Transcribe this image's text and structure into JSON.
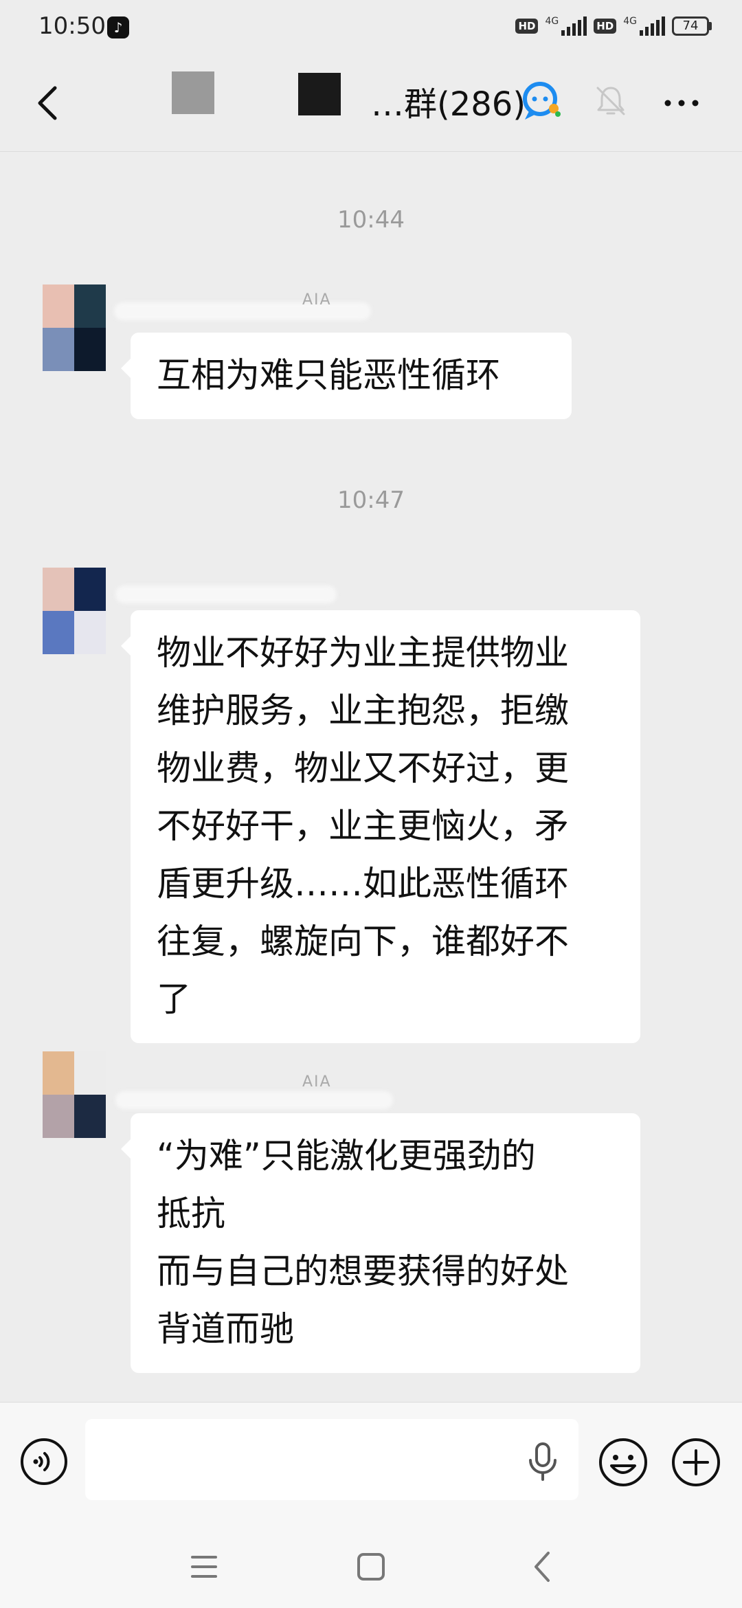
{
  "status_bar": {
    "time": "10:50",
    "hd1": "HD",
    "net1": "4G",
    "hd2": "HD",
    "net2": "4G",
    "battery": "74"
  },
  "header": {
    "title": "…群(286)"
  },
  "messages": [
    {
      "timestamp": "10:44",
      "nickname": "AIA",
      "lines": [
        "互相为难只能恶性循环"
      ]
    },
    {
      "timestamp": "10:47",
      "nickname": "",
      "lines": [
        "物业不好好为业主提供物业",
        "维护服务，业主抱怨，拒缴",
        "物业费，物业又不好过，更",
        "不好好干，业主更恼火，矛",
        "盾更升级……如此恶性循环",
        "往复，螺旋向下，谁都好不",
        "了"
      ]
    },
    {
      "timestamp": "",
      "nickname": "AIA",
      "lines": [
        "“为难”只能激化更强劲的",
        "抵抗",
        "而与自己的想要获得的好处",
        "背道而驰"
      ]
    }
  ],
  "input": {
    "placeholder": ""
  },
  "colors": {
    "background": "#ededed",
    "bubble": "#ffffff",
    "timestamp": "#9a9a9a",
    "group_icon": "#1d8cf0"
  }
}
